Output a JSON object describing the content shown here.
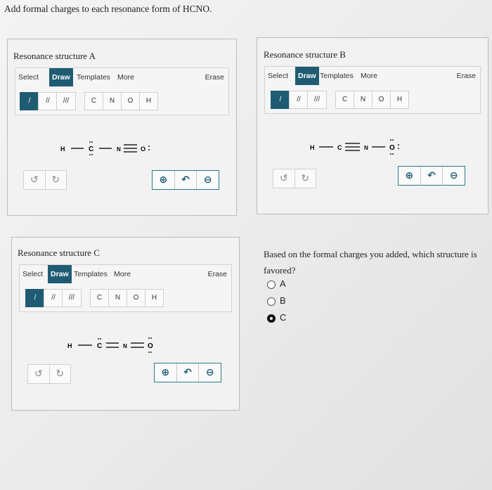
{
  "question": {
    "title": "Add formal charges to each resonance form of HCNO.",
    "prompt": "Based on the formal charges you added, which structure is favored?",
    "options": [
      {
        "label": "A",
        "selected": false
      },
      {
        "label": "B",
        "selected": false
      },
      {
        "label": "C",
        "selected": true
      }
    ]
  },
  "toolbar": {
    "select": "Select",
    "draw": "Draw",
    "templates": "Templates",
    "more": "More",
    "erase": "Erase",
    "bond_tools": [
      "/",
      "//",
      "///"
    ],
    "atoms": [
      "C",
      "N",
      "O",
      "H"
    ]
  },
  "panels": {
    "a": {
      "title": "Resonance structure A"
    },
    "b": {
      "title": "Resonance structure B"
    },
    "c": {
      "title": "Resonance structure C"
    }
  },
  "molecules": {
    "a": {
      "atoms": [
        "H",
        "C",
        "N",
        "O"
      ],
      "bonds": [
        "single",
        "single",
        "triple"
      ]
    },
    "b": {
      "atoms": [
        "H",
        "C",
        "N",
        "O"
      ],
      "bonds": [
        "single",
        "triple",
        "single"
      ]
    },
    "c": {
      "atoms": [
        "H",
        "C",
        "N",
        "O"
      ],
      "bonds": [
        "single",
        "double",
        "double"
      ]
    }
  },
  "icons": {
    "undo": "undo-icon",
    "redo": "redo-icon",
    "zoom_in": "zoom-in-icon",
    "reset": "reset-icon",
    "zoom_out": "zoom-out-icon"
  },
  "colors": {
    "accent": "#1f5c73",
    "selected_radio": "#111111"
  }
}
